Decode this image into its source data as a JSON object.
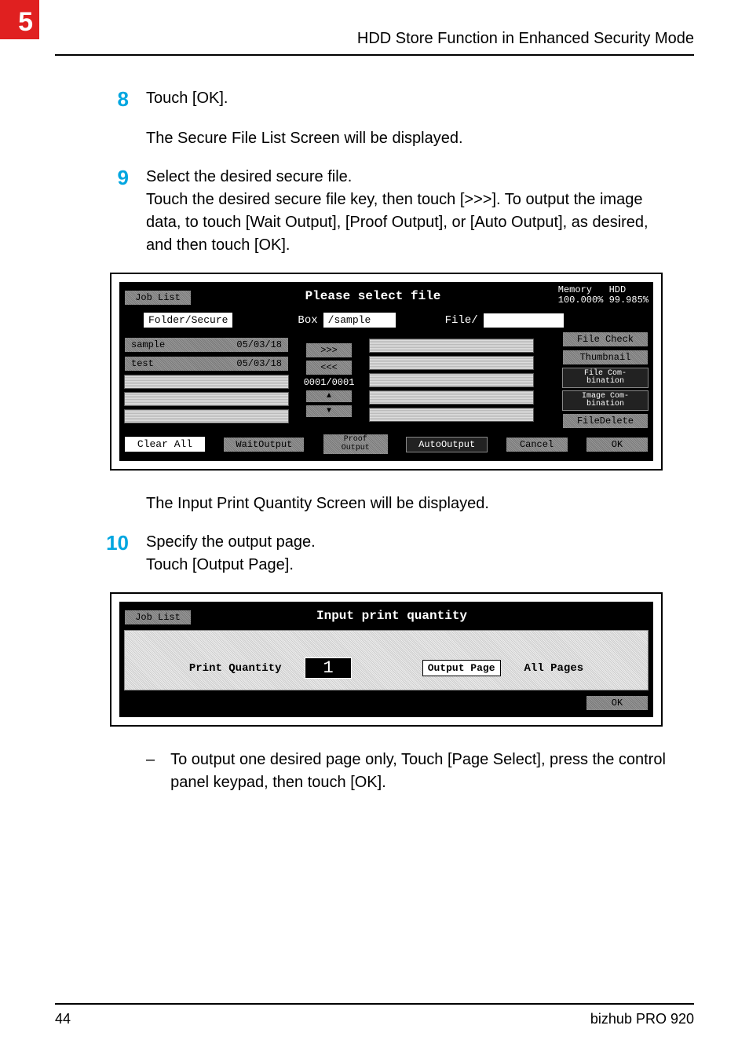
{
  "chapter_number": "5",
  "running_head": "HDD Store Function in Enhanced Security Mode",
  "steps": {
    "s8": {
      "num": "8",
      "line": "Touch [OK]."
    },
    "s8_para": "The Secure File List Screen will be displayed.",
    "s9": {
      "num": "9",
      "line": "Select the desired secure file.",
      "line2": "Touch the desired secure file key, then touch [>>>]. To output the image data, to touch [Wait Output], [Proof Output], or [Auto Output], as desired, and then touch [OK]."
    },
    "s9_after": "The Input Print Quantity Screen will be displayed.",
    "s10": {
      "num": "10",
      "line": "Specify the output page.",
      "line2": "Touch [Output Page]."
    },
    "bullet": "To output one desired page only, Touch [Page Select], press the control panel keypad, then touch [OK]."
  },
  "lcd1": {
    "job_list": "Job List",
    "title": "Please select file",
    "memory_label": "Memory",
    "memory_value": "100.000%",
    "hdd_label": "HDD",
    "hdd_value": "99.985%",
    "folder_secure": "Folder/Secure",
    "box_label": "Box",
    "box_value": "/sample",
    "file_label": "File/",
    "rows": [
      {
        "name": "sample",
        "date": "05/03/18"
      },
      {
        "name": "test",
        "date": "05/03/18"
      }
    ],
    "nav_next": ">>>",
    "nav_prev": "<<<",
    "counter": "0001/0001",
    "up_icon": "▲",
    "down_icon": "▼",
    "sidebar": [
      "File Check",
      "Thumbnail",
      "File Com-\nbination",
      "Image Com-\nbination",
      "FileDelete"
    ],
    "clear_all": "Clear All",
    "wait_output": "WaitOutput",
    "proof_output": "Proof\nOutput",
    "auto_output": "AutoOutput",
    "cancel": "Cancel",
    "ok": "OK"
  },
  "lcd2": {
    "job_list": "Job List",
    "title": "Input print quantity",
    "print_qty_label": "Print Quantity",
    "print_qty_value": "1",
    "output_page": "Output Page",
    "all_pages": "All Pages",
    "ok": "OK"
  },
  "footer": {
    "page": "44",
    "product": "bizhub PRO 920"
  }
}
